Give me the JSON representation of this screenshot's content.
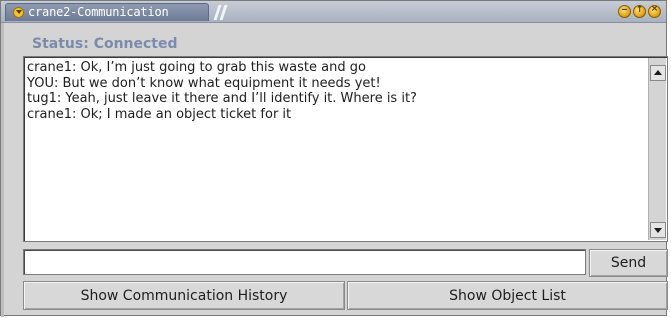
{
  "window": {
    "title": "crane2-Communication",
    "menu_icon": "window-menu-icon",
    "controls": [
      "minimize-icon",
      "maximize-icon",
      "close-icon"
    ],
    "title_tab_color": "#7d89a3",
    "titlebar_color": "#b4bcc8"
  },
  "status": {
    "text": "Status: Connected",
    "color": "#7c8aab"
  },
  "chat": {
    "lines": [
      "crane1: Ok, I’m just going to grab this waste and go",
      "YOU: But we don’t know what equipment it needs yet!",
      "tug1: Yeah, just leave it there and I’ll identify it. Where is it?",
      "crane1: Ok; I made an object ticket for it"
    ]
  },
  "input": {
    "value": "",
    "placeholder": ""
  },
  "buttons": {
    "send": "Send",
    "history": "Show Communication History",
    "objects": "Show Object List"
  }
}
